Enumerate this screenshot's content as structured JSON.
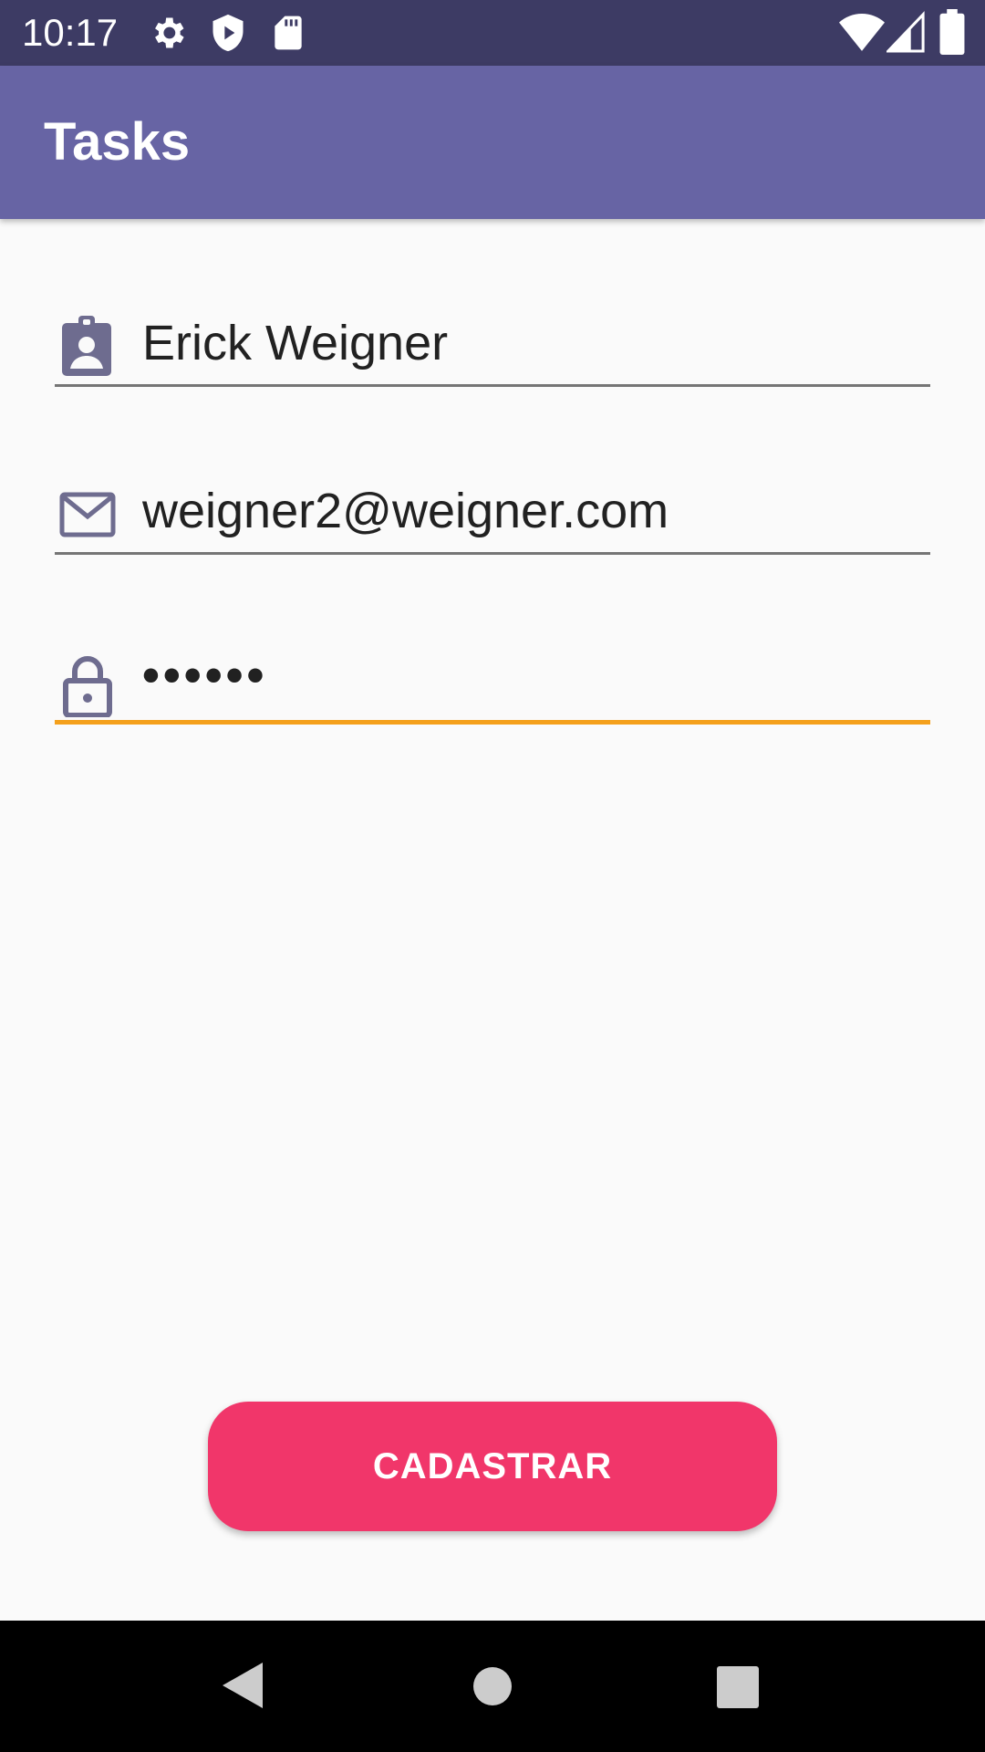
{
  "status_bar": {
    "time": "10:17",
    "icons": [
      "gear-icon",
      "shield-icon",
      "sd-card-icon",
      "wifi-icon",
      "signal-icon",
      "battery-icon"
    ]
  },
  "app_bar": {
    "title": "Tasks"
  },
  "form": {
    "name": {
      "icon": "contact-badge-icon",
      "value": "Erick Weigner"
    },
    "email": {
      "icon": "mail-icon",
      "value": "weigner2@weigner.com"
    },
    "password": {
      "icon": "lock-icon",
      "value": "••••••",
      "focused": true
    }
  },
  "actions": {
    "register_label": "CADASTRAR"
  },
  "nav_bar": {
    "buttons": [
      "back-icon",
      "home-icon",
      "recents-icon"
    ]
  },
  "colors": {
    "status_bar": "#3d3b64",
    "app_bar": "#6764a4",
    "accent": "#f4a01c",
    "button": "#f1366a",
    "icon_tint": "#6e6c8f"
  }
}
